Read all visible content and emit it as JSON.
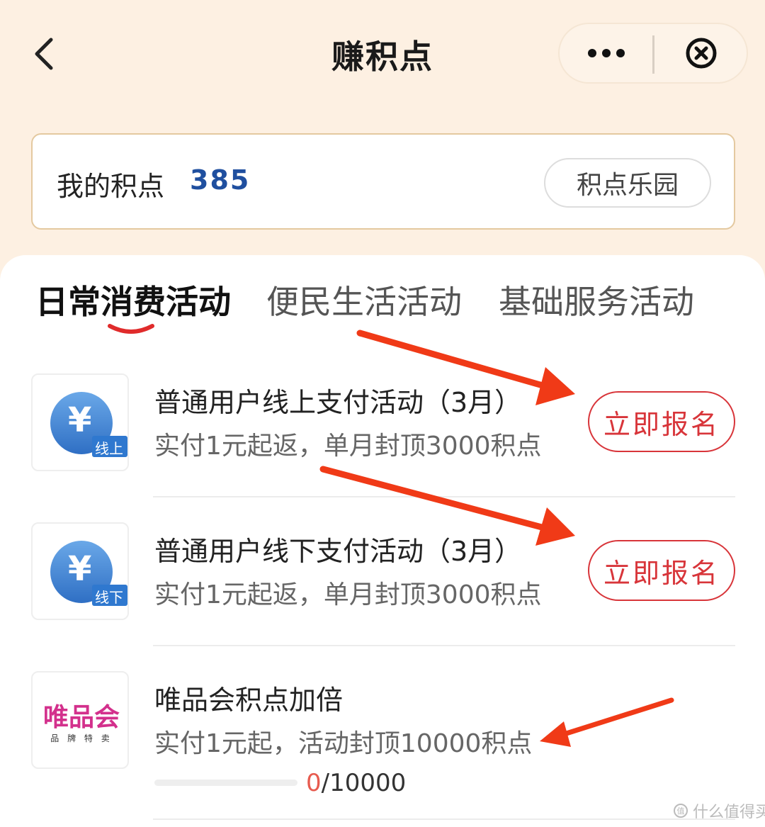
{
  "header": {
    "title": "赚积点",
    "back_icon": "chevron-left-icon",
    "more_icon": "more-dots-icon",
    "close_icon": "close-circle-icon"
  },
  "points": {
    "label": "我的积点",
    "value": "385",
    "park_button": "积点乐园"
  },
  "tabs": [
    {
      "label": "日常消费活动",
      "active": true
    },
    {
      "label": "便民生活活动",
      "active": false
    },
    {
      "label": "基础服务活动",
      "active": false
    }
  ],
  "activities": [
    {
      "logo_text": "¥",
      "logo_badge": "线上",
      "title": "普通用户线上支付活动（3月）",
      "subtitle": "实付1元起返，单月封顶3000积点",
      "button": "立即报名"
    },
    {
      "logo_text": "¥",
      "logo_badge": "线下",
      "title": "普通用户线下支付活动（3月）",
      "subtitle": "实付1元起返，单月封顶3000积点",
      "button": "立即报名"
    },
    {
      "logo_text": "唯品会",
      "logo_sub": "品 牌 特 卖",
      "title": "唯品会积点加倍",
      "subtitle": "实付1元起，活动封顶10000积点",
      "progress_current": "0",
      "progress_total": "/10000",
      "progress_fraction": 0
    }
  ],
  "colors": {
    "accent_red": "#d8353a",
    "points_blue": "#1f4f9f",
    "bg_cream": "#fdf0e2",
    "arrow_red": "#f03a17"
  },
  "watermark": "什么值得买"
}
